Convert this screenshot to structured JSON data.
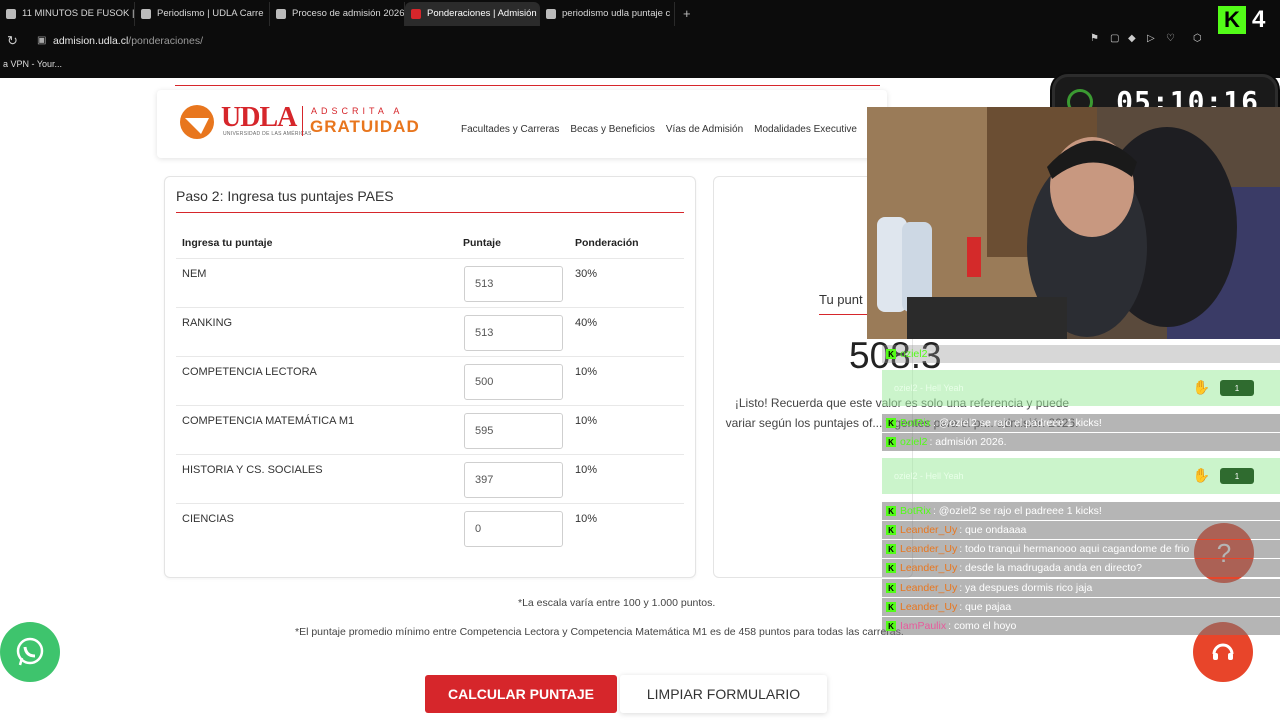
{
  "browser": {
    "tabs": [
      {
        "label": "11 MINUTOS DE FUSOK | M",
        "active": false
      },
      {
        "label": "Periodismo | UDLA Carre",
        "active": false
      },
      {
        "label": "Proceso de admisión 2026",
        "active": false
      },
      {
        "label": "Ponderaciones | Admisión",
        "active": true
      },
      {
        "label": "periodismo udla puntaje c",
        "active": false
      }
    ],
    "new_tab": "+",
    "url_host": "admision.udla.cl",
    "url_path": "/ponderaciones/",
    "url_prefix": "",
    "bookmark": "a VPN - Your..."
  },
  "site": {
    "logo_text": "UDLA",
    "logo_sub": "UNIVERSIDAD DE LAS AMÉRICAS",
    "logo_adscrita": "ADSCRITA A",
    "logo_gratuidad": "GRATUIDAD",
    "nav": [
      "Facultades y Carreras",
      "Becas y Beneficios",
      "Vías de Admisión",
      "Modalidades Executive"
    ]
  },
  "form": {
    "title": "Paso 2: Ingresa tus puntajes PAES",
    "col_score_name": "Ingresa tu puntaje",
    "col_score": "Puntaje",
    "col_weight": "Ponderación",
    "rows": [
      {
        "label": "NEM",
        "value": "513",
        "weight": "30%"
      },
      {
        "label": "RANKING",
        "value": "513",
        "weight": "40%"
      },
      {
        "label": "COMPETENCIA LECTORA",
        "value": "500",
        "weight": "10%"
      },
      {
        "label": "COMPETENCIA MATEMÁTICA M1",
        "value": "595",
        "weight": "10%"
      },
      {
        "label": "HISTORIA Y CS. SOCIALES",
        "value": "397",
        "weight": "10%"
      },
      {
        "label": "CIENCIAS",
        "value": "0",
        "weight": "10%"
      }
    ]
  },
  "result": {
    "title": "Tu punt",
    "score": "508.3",
    "text": "¡Listo! Recuerda que este valor es solo una referencia y puede variar según los puntajes of... vigentes para el pr... admisión 2026."
  },
  "notes": {
    "scale": "*La escala varía entre 100 y 1.000 puntos.",
    "minimum": "*El puntaje promedio mínimo entre Competencia Lectora y Competencia Matemática M1 es de 458 puntos para todas las carreras."
  },
  "buttons": {
    "calculate": "CALCULAR PUNTAJE",
    "clear": "LIMPIAR FORMULARIO"
  },
  "stream": {
    "timer": "05:10:16",
    "viewers": "4",
    "chat": [
      {
        "user": "oziel2",
        "text": ":",
        "user_color": "#53fc18"
      },
      {
        "user": "BotRix",
        "text": ": @oziel2 se rajo el padreee 1 kicks!",
        "user_color": "#53fc18"
      },
      {
        "user": "oziel2",
        "text": ": admisión 2026.",
        "user_color": "#53fc18"
      },
      {
        "user": "BotRix",
        "text": ": @oziel2 se rajo el padreee 1 kicks!",
        "user_color": "#53fc18"
      },
      {
        "user": "Leander_Uy",
        "text": ": que ondaaaa",
        "user_color": "#e8761e"
      },
      {
        "user": "Leander_Uy",
        "text": ": todo tranqui hermanooo aqui cagandome de frio",
        "user_color": "#e8761e"
      },
      {
        "user": "Leander_Uy",
        "text": ": desde la madrugada anda en directo?",
        "user_color": "#e8761e"
      },
      {
        "user": "Leander_Uy",
        "text": ": ya despues dormis rico jaja",
        "user_color": "#e8761e"
      },
      {
        "user": "Leander_Uy",
        "text": ": que pajaa",
        "user_color": "#e8761e"
      },
      {
        "user": "IamPaulix",
        "text": ": como el hoyo",
        "user_color": "#e85a9c"
      }
    ],
    "highlights": [
      {
        "user": "oziel2",
        "text": "- Hell Yeah",
        "tag": "1"
      },
      {
        "user": "oziel2",
        "text": "- Hell Yeah",
        "tag": "1"
      }
    ]
  },
  "colors": {
    "brand_red": "#d6262b",
    "brand_orange": "#e8761e",
    "kick_green": "#53fc18"
  }
}
